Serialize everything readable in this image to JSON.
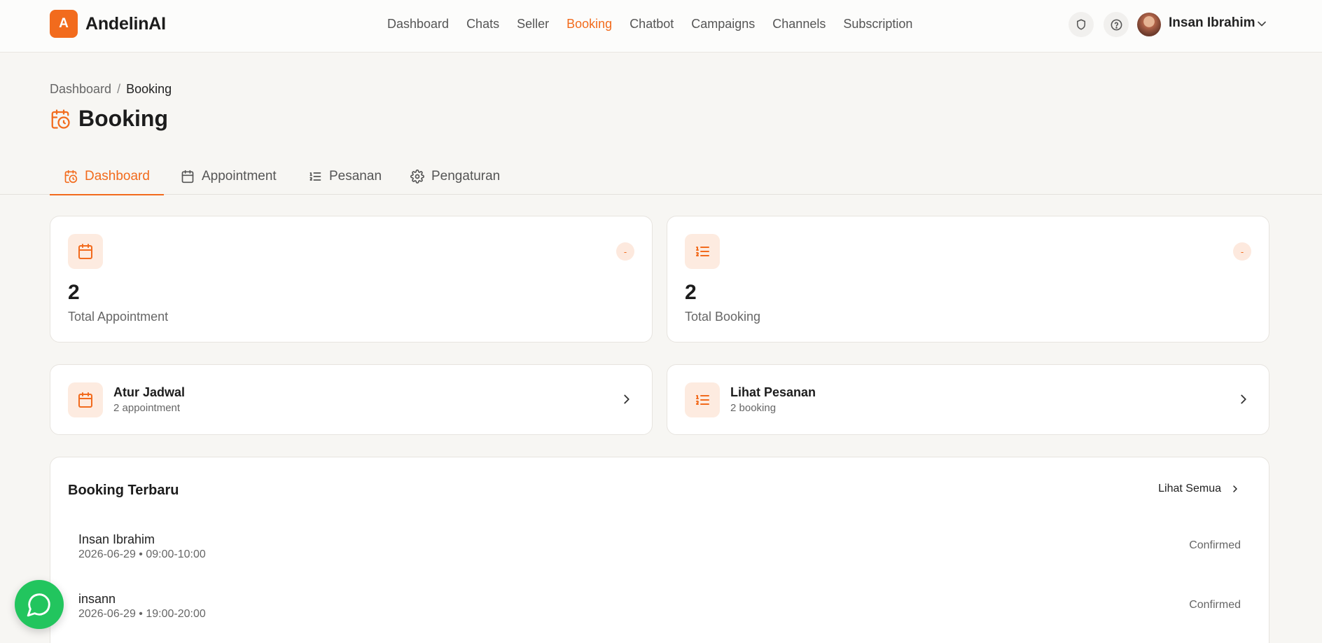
{
  "app": {
    "logo_letter": "A",
    "name": "AndelinAI"
  },
  "nav": {
    "items": [
      {
        "label": "Dashboard"
      },
      {
        "label": "Chats"
      },
      {
        "label": "Seller"
      },
      {
        "label": "Booking",
        "active": true
      },
      {
        "label": "Chatbot"
      },
      {
        "label": "Campaigns"
      },
      {
        "label": "Channels"
      },
      {
        "label": "Subscription"
      }
    ]
  },
  "header": {
    "icons": [
      "shield-icon",
      "help-circle-icon"
    ],
    "user": {
      "name": "Insan Ibrahim"
    }
  },
  "breadcrumb": {
    "root": "Dashboard",
    "separator": "/",
    "current": "Booking"
  },
  "page": {
    "title": "Booking",
    "title_icon": "calendar-clock-icon"
  },
  "tabs": [
    {
      "label": "Dashboard",
      "icon": "calendar-clock-icon",
      "active": true
    },
    {
      "label": "Appointment",
      "icon": "calendar-icon"
    },
    {
      "label": "Pesanan",
      "icon": "list-ordered-icon"
    },
    {
      "label": "Pengaturan",
      "icon": "gear-icon"
    }
  ],
  "stats": [
    {
      "value": "2",
      "label": "Total Appointment",
      "badge": "-",
      "icon": "calendar-icon"
    },
    {
      "value": "2",
      "label": "Total Booking",
      "badge": "-",
      "icon": "list-ordered-icon"
    }
  ],
  "actions": [
    {
      "title": "Atur Jadwal",
      "subtitle": "2 appointment",
      "icon": "calendar-icon"
    },
    {
      "title": "Lihat Pesanan",
      "subtitle": "2 booking",
      "icon": "list-ordered-icon"
    }
  ],
  "recent": {
    "title": "Booking Terbaru",
    "see_all": "Lihat Semua",
    "rows": [
      {
        "name": "Insan Ibrahim",
        "meta": "2026-06-29 • 09:00-10:00",
        "status": "Confirmed"
      },
      {
        "name": "insann",
        "meta": "2026-06-29 • 19:00-20:00",
        "status": "Confirmed"
      }
    ]
  },
  "colors": {
    "accent": "#f26b1d",
    "accent_soft": "#fdebe0",
    "chat_fab": "#22c55e",
    "background": "#f7f6f3"
  }
}
